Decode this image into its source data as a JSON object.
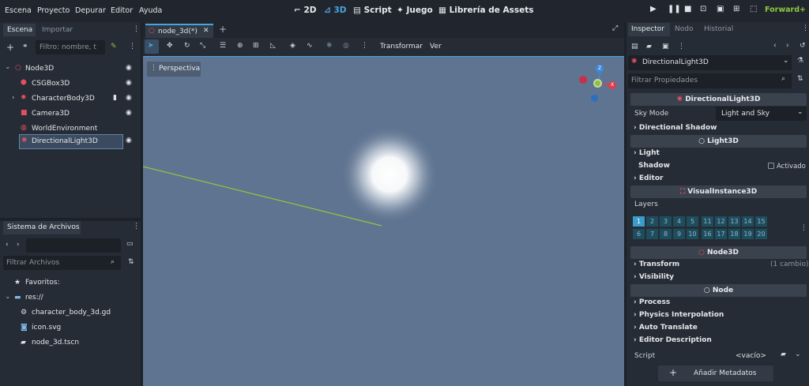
{
  "menubar": {
    "items": [
      "Escena",
      "Proyecto",
      "Depurar",
      "Editor",
      "Ayuda"
    ]
  },
  "workspaces": {
    "2d": "2D",
    "3d": "3D",
    "script": "Script",
    "game": "Juego",
    "assetlib": "Librería de Assets"
  },
  "renderer": "Forward+",
  "scene_dock": {
    "tab_active": "Escena",
    "tab_other": "Importar",
    "filter_placeholder": "Filtro: nombre, t",
    "nodes": [
      "Node3D",
      "CSGBox3D",
      "CharacterBody3D",
      "Camera3D",
      "WorldEnvironment",
      "DirectionalLight3D"
    ]
  },
  "filesystem": {
    "title": "Sistema de Archivos",
    "filter_placeholder": "Filtrar Archivos",
    "favorites": "Favoritos:",
    "root": "res://",
    "files": [
      "character_body_3d.gd",
      "icon.svg",
      "node_3d.tscn"
    ]
  },
  "editor": {
    "tab_title": "node_3d(*)",
    "menu_transform": "Transformar",
    "menu_view": "Ver",
    "perspective": "Perspectiva",
    "gizmo": {
      "z": "Z",
      "x": "X"
    }
  },
  "inspector": {
    "tabs": [
      "Inspector",
      "Nodo",
      "Historial"
    ],
    "object_name": "DirectionalLight3D",
    "filter_placeholder": "Filtrar Propiedades",
    "section_directional": "DirectionalLight3D",
    "sky_mode_label": "Sky Mode",
    "sky_mode_value": "Light and Sky",
    "directional_shadow": "Directional Shadow",
    "section_light": "Light3D",
    "light": "Light",
    "shadow": "Shadow",
    "shadow_value": "Activado",
    "editor": "Editor",
    "section_visual": "VisualInstance3D",
    "layers_label": "Layers",
    "layers_row1": [
      "1",
      "2",
      "3",
      "4",
      "5",
      "11",
      "12",
      "13",
      "14",
      "15"
    ],
    "layers_row2": [
      "6",
      "7",
      "8",
      "9",
      "10",
      "16",
      "17",
      "18",
      "19",
      "20"
    ],
    "section_node3d": "Node3D",
    "transform": "Transform",
    "transform_changes": "(1 cambio)",
    "visibility": "Visibility",
    "section_node": "Node",
    "process": "Process",
    "physics_interp": "Physics Interpolation",
    "auto_translate": "Auto Translate",
    "editor_desc": "Editor Description",
    "script_label": "Script",
    "script_value": "<vacío>",
    "add_metadata": "Añadir Metadatos"
  },
  "colors": {
    "accent": "#4aa3df",
    "viewport": "#5f7491",
    "green": "#8fc73e",
    "gizmo_red": "#e03b4e",
    "gizmo_green": "#88c43a",
    "gizmo_blue": "#3a8be0"
  }
}
